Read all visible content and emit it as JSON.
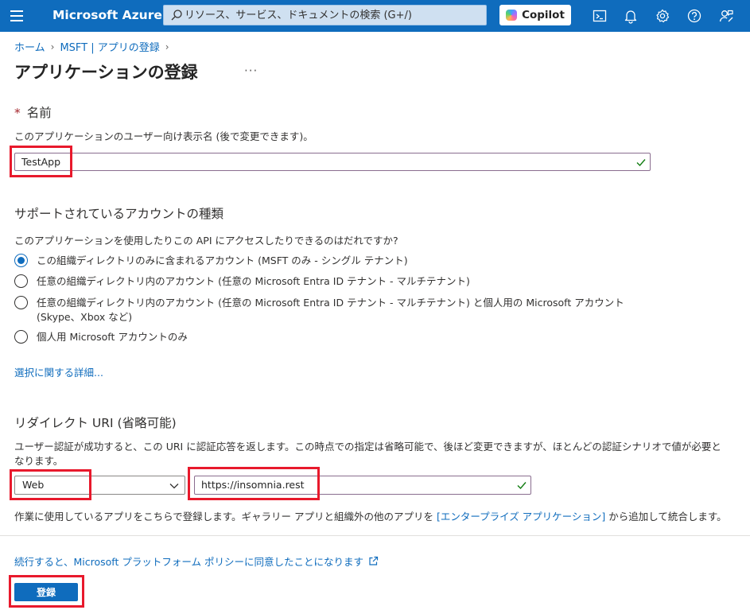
{
  "topbar": {
    "brand": "Microsoft Azure",
    "search_placeholder": "リソース、サービス、ドキュメントの検索 (G+/)",
    "copilot_label": "Copilot"
  },
  "breadcrumb": {
    "home": "ホーム",
    "parent": "MSFT | アプリの登録"
  },
  "page": {
    "title": "アプリケーションの登録",
    "more": "···"
  },
  "name_section": {
    "required_mark": "*",
    "title": "名前",
    "description": "このアプリケーションのユーザー向け表示名 (後で変更できます)。",
    "value": "TestApp"
  },
  "account_section": {
    "title": "サポートされているアカウントの種類",
    "question": "このアプリケーションを使用したりこの API にアクセスしたりできるのはだれですか?",
    "options": [
      {
        "label": "この組織ディレクトリのみに含まれるアカウント (MSFT のみ - シングル テナント)",
        "selected": true
      },
      {
        "label": "任意の組織ディレクトリ内のアカウント (任意の Microsoft Entra ID テナント - マルチテナント)",
        "selected": false
      },
      {
        "label": "任意の組織ディレクトリ内のアカウント (任意の Microsoft Entra ID テナント - マルチテナント) と個人用の Microsoft アカウント (Skype、Xbox など)",
        "selected": false
      },
      {
        "label": "個人用 Microsoft アカウントのみ",
        "selected": false
      }
    ],
    "help_link": "選択に関する詳細..."
  },
  "redirect_section": {
    "title": "リダイレクト URI (省略可能)",
    "description_line1": "ユーザー認証が成功すると、この URI に認証応答を返します。この時点での指定は省略可能で、後ほど変更できますが、ほとんどの認証シナリオで値が必要と",
    "description_line2": "なります。",
    "platform": "Web",
    "uri": "https://insomnia.rest",
    "note_before": "作業に使用しているアプリをこちらで登録します。ギャラリー アプリと組織外の他のアプリを ",
    "note_link": "[エンタープライズ アプリケーション]",
    "note_after": " から追加して統合します。"
  },
  "footer": {
    "policy_link": "続行すると、Microsoft プラットフォーム ポリシーに同意したことになります",
    "register_button": "登録"
  },
  "colors": {
    "accent": "#0f6cbd",
    "annotation_red": "#e8192c",
    "success_check": "#107c10"
  }
}
